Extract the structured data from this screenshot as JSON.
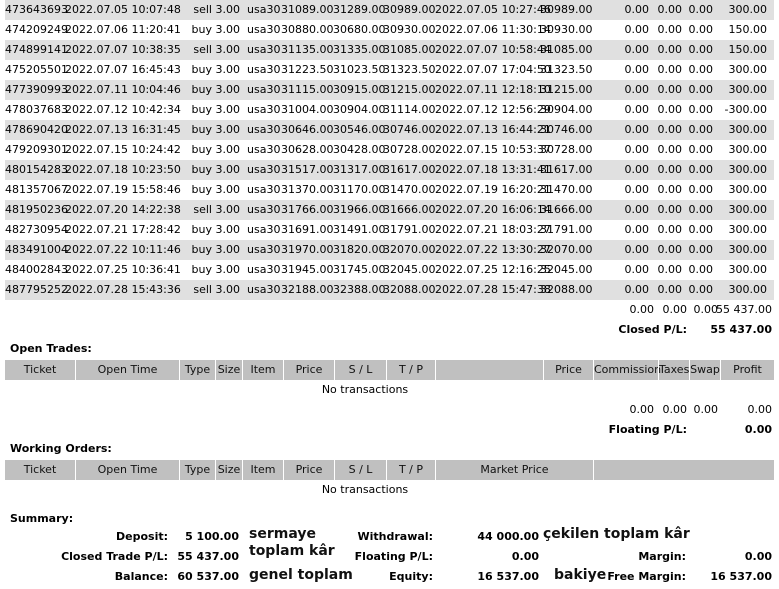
{
  "closed_trades": [
    {
      "ticket": "473643693",
      "open_time": "2022.07.05 10:07:48",
      "type": "sell",
      "size": "3.00",
      "item": "usa30",
      "price": "31089.00",
      "sl": "31289.00",
      "tp": "30989.00",
      "close_time": "2022.07.05 10:27:46",
      "close_price": "30989.00",
      "commission": "0.00",
      "taxes": "0.00",
      "swap": "0.00",
      "profit": "300.00"
    },
    {
      "ticket": "474209249",
      "open_time": "2022.07.06 11:20:41",
      "type": "buy",
      "size": "3.00",
      "item": "usa30",
      "price": "30880.00",
      "sl": "30680.00",
      "tp": "30930.00",
      "close_time": "2022.07.06 11:30:14",
      "close_price": "30930.00",
      "commission": "0.00",
      "taxes": "0.00",
      "swap": "0.00",
      "profit": "150.00"
    },
    {
      "ticket": "474899141",
      "open_time": "2022.07.07 10:38:35",
      "type": "sell",
      "size": "3.00",
      "item": "usa30",
      "price": "31135.00",
      "sl": "31335.00",
      "tp": "31085.00",
      "close_time": "2022.07.07 10:58:44",
      "close_price": "31085.00",
      "commission": "0.00",
      "taxes": "0.00",
      "swap": "0.00",
      "profit": "150.00"
    },
    {
      "ticket": "475205501",
      "open_time": "2022.07.07 16:45:43",
      "type": "buy",
      "size": "3.00",
      "item": "usa30",
      "price": "31223.50",
      "sl": "31023.50",
      "tp": "31323.50",
      "close_time": "2022.07.07 17:04:50",
      "close_price": "31323.50",
      "commission": "0.00",
      "taxes": "0.00",
      "swap": "0.00",
      "profit": "300.00"
    },
    {
      "ticket": "477390993",
      "open_time": "2022.07.11 10:04:46",
      "type": "buy",
      "size": "3.00",
      "item": "usa30",
      "price": "31115.00",
      "sl": "30915.00",
      "tp": "31215.00",
      "close_time": "2022.07.11 12:18:10",
      "close_price": "31215.00",
      "commission": "0.00",
      "taxes": "0.00",
      "swap": "0.00",
      "profit": "300.00"
    },
    {
      "ticket": "478037683",
      "open_time": "2022.07.12 10:42:34",
      "type": "buy",
      "size": "3.00",
      "item": "usa30",
      "price": "31004.00",
      "sl": "30904.00",
      "tp": "31114.00",
      "close_time": "2022.07.12 12:56:29",
      "close_price": "30904.00",
      "commission": "0.00",
      "taxes": "0.00",
      "swap": "0.00",
      "profit": "-300.00"
    },
    {
      "ticket": "478690420",
      "open_time": "2022.07.13 16:31:45",
      "type": "buy",
      "size": "3.00",
      "item": "usa30",
      "price": "30646.00",
      "sl": "30546.00",
      "tp": "30746.00",
      "close_time": "2022.07.13 16:44:21",
      "close_price": "30746.00",
      "commission": "0.00",
      "taxes": "0.00",
      "swap": "0.00",
      "profit": "300.00"
    },
    {
      "ticket": "479209301",
      "open_time": "2022.07.15 10:24:42",
      "type": "buy",
      "size": "3.00",
      "item": "usa30",
      "price": "30628.00",
      "sl": "30428.00",
      "tp": "30728.00",
      "close_time": "2022.07.15 10:53:37",
      "close_price": "30728.00",
      "commission": "0.00",
      "taxes": "0.00",
      "swap": "0.00",
      "profit": "300.00"
    },
    {
      "ticket": "480154283",
      "open_time": "2022.07.18 10:23:50",
      "type": "buy",
      "size": "3.00",
      "item": "usa30",
      "price": "31517.00",
      "sl": "31317.00",
      "tp": "31617.00",
      "close_time": "2022.07.18 13:31:41",
      "close_price": "31617.00",
      "commission": "0.00",
      "taxes": "0.00",
      "swap": "0.00",
      "profit": "300.00"
    },
    {
      "ticket": "481357067",
      "open_time": "2022.07.19 15:58:46",
      "type": "buy",
      "size": "3.00",
      "item": "usa30",
      "price": "31370.00",
      "sl": "31170.00",
      "tp": "31470.00",
      "close_time": "2022.07.19 16:20:21",
      "close_price": "31470.00",
      "commission": "0.00",
      "taxes": "0.00",
      "swap": "0.00",
      "profit": "300.00"
    },
    {
      "ticket": "481950236",
      "open_time": "2022.07.20 14:22:38",
      "type": "sell",
      "size": "3.00",
      "item": "usa30",
      "price": "31766.00",
      "sl": "31966.00",
      "tp": "31666.00",
      "close_time": "2022.07.20 16:06:14",
      "close_price": "31666.00",
      "commission": "0.00",
      "taxes": "0.00",
      "swap": "0.00",
      "profit": "300.00"
    },
    {
      "ticket": "482730954",
      "open_time": "2022.07.21 17:28:42",
      "type": "buy",
      "size": "3.00",
      "item": "usa30",
      "price": "31691.00",
      "sl": "31491.00",
      "tp": "31791.00",
      "close_time": "2022.07.21 18:03:27",
      "close_price": "31791.00",
      "commission": "0.00",
      "taxes": "0.00",
      "swap": "0.00",
      "profit": "300.00"
    },
    {
      "ticket": "483491004",
      "open_time": "2022.07.22 10:11:46",
      "type": "buy",
      "size": "3.00",
      "item": "usa30",
      "price": "31970.00",
      "sl": "31820.00",
      "tp": "32070.00",
      "close_time": "2022.07.22 13:30:27",
      "close_price": "32070.00",
      "commission": "0.00",
      "taxes": "0.00",
      "swap": "0.00",
      "profit": "300.00"
    },
    {
      "ticket": "484002843",
      "open_time": "2022.07.25 10:36:41",
      "type": "buy",
      "size": "3.00",
      "item": "usa30",
      "price": "31945.00",
      "sl": "31745.00",
      "tp": "32045.00",
      "close_time": "2022.07.25 12:16:25",
      "close_price": "32045.00",
      "commission": "0.00",
      "taxes": "0.00",
      "swap": "0.00",
      "profit": "300.00"
    },
    {
      "ticket": "487795252",
      "open_time": "2022.07.28 15:43:36",
      "type": "sell",
      "size": "3.00",
      "item": "usa30",
      "price": "32188.00",
      "sl": "32388.00",
      "tp": "32088.00",
      "close_time": "2022.07.28 15:47:38",
      "close_price": "32088.00",
      "commission": "0.00",
      "taxes": "0.00",
      "swap": "0.00",
      "profit": "300.00"
    }
  ],
  "closed_totals": {
    "commission": "0.00",
    "taxes": "0.00",
    "swap": "0.00",
    "profit": "55 437.00",
    "label": "Closed P/L:",
    "value": "55 437.00"
  },
  "open_trades": {
    "title": "Open Trades:",
    "headers": {
      "ticket": "Ticket",
      "open_time": "Open Time",
      "type": "Type",
      "size": "Size",
      "item": "Item",
      "price": "Price",
      "sl": "S / L",
      "tp": "T / P",
      "price2": "Price",
      "commission": "Commission",
      "taxes": "Taxes",
      "swap": "Swap",
      "profit": "Profit"
    },
    "empty": "No transactions",
    "totals": {
      "commission": "0.00",
      "taxes": "0.00",
      "swap": "0.00",
      "profit": "0.00"
    },
    "floating_label": "Floating P/L:",
    "floating_value": "0.00"
  },
  "working_orders": {
    "title": "Working Orders:",
    "headers": {
      "ticket": "Ticket",
      "open_time": "Open Time",
      "type": "Type",
      "size": "Size",
      "item": "Item",
      "price": "Price",
      "sl": "S / L",
      "tp": "T / P",
      "market_price": "Market Price"
    },
    "empty": "No transactions"
  },
  "summary": {
    "title": "Summary:",
    "deposit_label": "Deposit:",
    "deposit_value": "5 100.00",
    "closed_pl_label": "Closed Trade P/L:",
    "closed_pl_value": "55 437.00",
    "balance_label": "Balance:",
    "balance_value": "60 537.00",
    "withdrawal_label": "Withdrawal:",
    "withdrawal_value": "44 000.00",
    "floating_label": "Floating P/L:",
    "floating_value": "0.00",
    "equity_label": "Equity:",
    "equity_value": "16 537.00",
    "margin_label": "Margin:",
    "margin_value": "0.00",
    "free_margin_label": "Free Margin:",
    "free_margin_value": "16 537.00"
  },
  "annotations": {
    "sermaye": "sermaye",
    "toplam_kar": "toplam kâr",
    "genel_toplam": "genel toplam",
    "cekilen": "çekilen toplam kâr",
    "bakiye": "bakiye"
  }
}
